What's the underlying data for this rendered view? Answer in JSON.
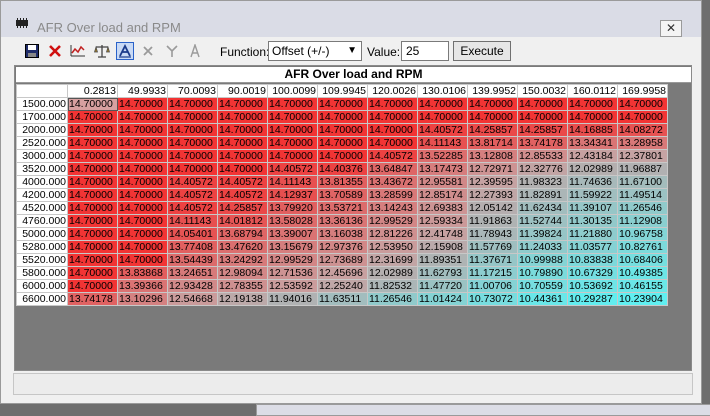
{
  "window": {
    "title": "AFR Over load and RPM",
    "close_label": "✕"
  },
  "toolbar": {
    "icons": [
      "save-icon",
      "delete-icon",
      "graph-icon",
      "balance-icon",
      "interpolate-icon",
      "multiply-icon",
      "smooth-icon",
      "font-icon"
    ],
    "function_label": "Function:",
    "function_value": "Offset (+/-)",
    "value_label": "Value:",
    "value": "25",
    "execute_label": "Execute"
  },
  "table": {
    "title": "AFR Over load and RPM",
    "columns": [
      "0.2813",
      "49.9933",
      "70.0093",
      "90.0019",
      "100.0099",
      "109.9945",
      "120.0026",
      "130.0106",
      "139.9952",
      "150.0032",
      "160.0112",
      "169.9958"
    ],
    "rows": [
      {
        "rpm": "1500.000",
        "cells": [
          "14.70000",
          "14.70000",
          "14.70000",
          "14.70000",
          "14.70000",
          "14.70000",
          "14.70000",
          "14.70000",
          "14.70000",
          "14.70000",
          "14.70000",
          "14.70000"
        ]
      },
      {
        "rpm": "1700.000",
        "cells": [
          "14.70000",
          "14.70000",
          "14.70000",
          "14.70000",
          "14.70000",
          "14.70000",
          "14.70000",
          "14.70000",
          "14.70000",
          "14.70000",
          "14.70000",
          "14.70000"
        ]
      },
      {
        "rpm": "2000.000",
        "cells": [
          "14.70000",
          "14.70000",
          "14.70000",
          "14.70000",
          "14.70000",
          "14.70000",
          "14.70000",
          "14.40572",
          "14.25857",
          "14.25857",
          "14.16885",
          "14.08272"
        ]
      },
      {
        "rpm": "2520.000",
        "cells": [
          "14.70000",
          "14.70000",
          "14.70000",
          "14.70000",
          "14.70000",
          "14.70000",
          "14.70000",
          "14.11143",
          "13.81714",
          "13.74178",
          "13.34341",
          "13.28958"
        ]
      },
      {
        "rpm": "3000.000",
        "cells": [
          "14.70000",
          "14.70000",
          "14.70000",
          "14.70000",
          "14.70000",
          "14.70000",
          "14.40572",
          "13.52285",
          "13.12808",
          "12.85533",
          "12.43184",
          "12.37801"
        ]
      },
      {
        "rpm": "3520.000",
        "cells": [
          "14.70000",
          "14.70000",
          "14.70000",
          "14.70000",
          "14.40572",
          "14.40376",
          "13.64847",
          "13.17473",
          "12.72971",
          "12.32776",
          "12.02989",
          "11.96887"
        ]
      },
      {
        "rpm": "4000.000",
        "cells": [
          "14.70000",
          "14.70000",
          "14.40572",
          "14.40572",
          "14.11143",
          "13.81355",
          "13.43672",
          "12.95581",
          "12.39595",
          "11.98323",
          "11.74636",
          "11.67100"
        ]
      },
      {
        "rpm": "4200.000",
        "cells": [
          "14.70000",
          "14.70000",
          "14.40572",
          "14.40572",
          "14.12937",
          "13.70589",
          "13.28599",
          "12.85174",
          "12.27393",
          "11.82891",
          "11.59922",
          "11.49514"
        ]
      },
      {
        "rpm": "4520.000",
        "cells": [
          "14.70000",
          "14.70000",
          "14.40572",
          "14.25857",
          "13.79920",
          "13.53721",
          "13.14243",
          "12.69383",
          "12.05142",
          "11.62434",
          "11.39107",
          "11.26546"
        ]
      },
      {
        "rpm": "4760.000",
        "cells": [
          "14.70000",
          "14.70000",
          "14.11143",
          "14.01812",
          "13.58028",
          "13.36136",
          "12.99529",
          "12.59334",
          "11.91863",
          "11.52744",
          "11.30135",
          "11.12908"
        ]
      },
      {
        "rpm": "5000.000",
        "cells": [
          "14.70000",
          "14.70000",
          "14.05401",
          "13.68794",
          "13.39007",
          "13.16038",
          "12.81226",
          "12.41748",
          "11.78943",
          "11.39824",
          "11.21880",
          "10.96758"
        ]
      },
      {
        "rpm": "5280.000",
        "cells": [
          "14.70000",
          "14.70000",
          "13.77408",
          "13.47620",
          "13.15679",
          "12.97376",
          "12.53950",
          "12.15908",
          "11.57769",
          "11.24033",
          "11.03577",
          "10.82761"
        ]
      },
      {
        "rpm": "5520.000",
        "cells": [
          "14.70000",
          "14.70000",
          "13.54439",
          "13.24292",
          "12.99529",
          "12.73689",
          "12.31699",
          "11.89351",
          "11.37671",
          "10.99988",
          "10.83838",
          "10.68406"
        ]
      },
      {
        "rpm": "5800.000",
        "cells": [
          "14.70000",
          "13.83868",
          "13.24651",
          "12.98094",
          "12.71536",
          "12.45696",
          "12.02989",
          "11.62793",
          "11.17215",
          "10.79890",
          "10.67329",
          "10.49385"
        ]
      },
      {
        "rpm": "6000.000",
        "cells": [
          "14.70000",
          "13.39366",
          "12.93428",
          "12.78355",
          "12.53592",
          "12.25240",
          "11.82532",
          "11.47720",
          "11.00706",
          "10.70559",
          "10.53692",
          "10.46155"
        ]
      },
      {
        "rpm": "6600.000",
        "cells": [
          "13.74178",
          "13.10296",
          "12.54668",
          "12.19138",
          "11.94016",
          "11.63511",
          "11.26546",
          "11.01424",
          "10.73072",
          "10.44361",
          "10.29287",
          "10.23904"
        ]
      }
    ]
  },
  "colors": {
    "high": "#f23434",
    "mid": "#c8a0a0",
    "low": "#5ef0f2",
    "selected": "#d7a0a0"
  }
}
